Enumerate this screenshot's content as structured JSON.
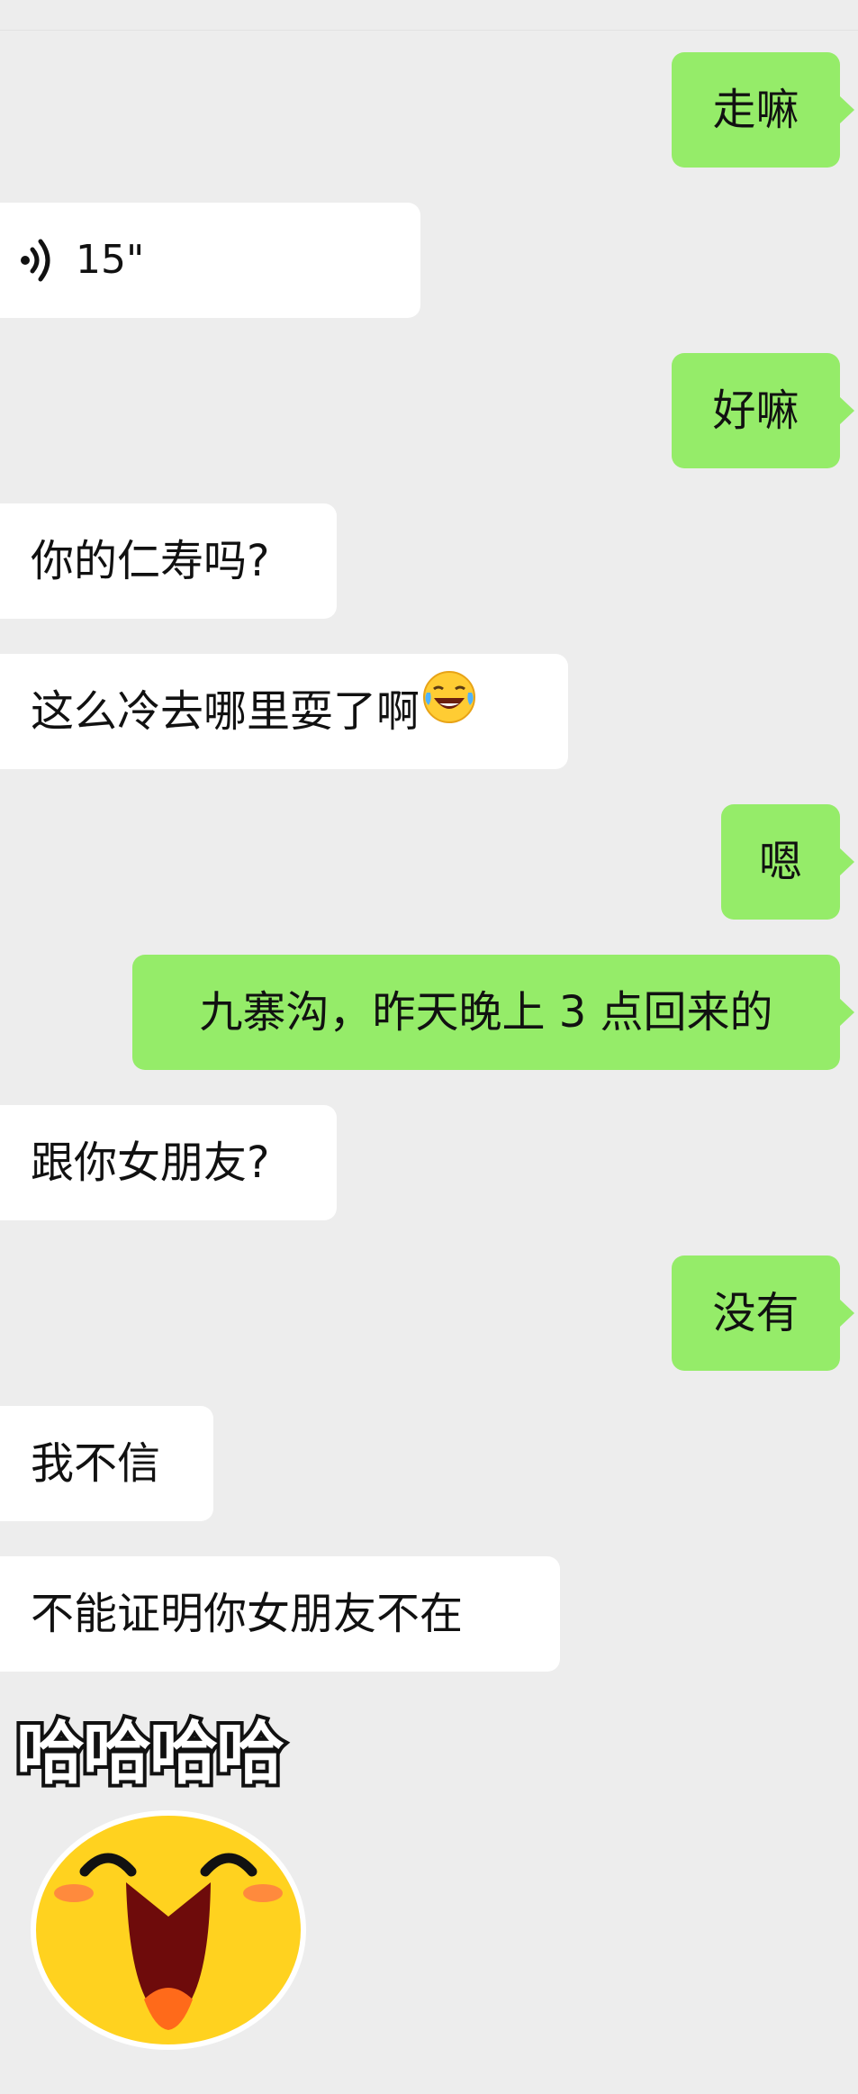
{
  "messages": [
    {
      "side": "out",
      "type": "text",
      "text": "走嘛"
    },
    {
      "side": "in",
      "type": "voice",
      "duration": "15\""
    },
    {
      "side": "out",
      "type": "text",
      "text": "好嘛"
    },
    {
      "side": "in",
      "type": "text",
      "text": "你的仁寿吗?"
    },
    {
      "side": "in",
      "type": "text",
      "text": "这么冷去哪里耍了啊",
      "emoji": "laughing-crying-emoji"
    },
    {
      "side": "out",
      "type": "text",
      "text": "嗯"
    },
    {
      "side": "out",
      "type": "text",
      "text": "九寨沟，昨天晚上 3 点回来的"
    },
    {
      "side": "in",
      "type": "text",
      "text": "跟你女朋友?"
    },
    {
      "side": "out",
      "type": "text",
      "text": "没有"
    },
    {
      "side": "in",
      "type": "text",
      "text": "我不信"
    },
    {
      "side": "in",
      "type": "text",
      "text": "不能证明你女朋友不在"
    },
    {
      "side": "in",
      "type": "sticker",
      "text": "哈哈哈哈",
      "icon": "laughing-face-sticker"
    }
  ],
  "colors": {
    "background": "#ededed",
    "incoming_bubble": "#ffffff",
    "outgoing_bubble": "#95ec69",
    "sticker_face": "#ffd21f"
  }
}
